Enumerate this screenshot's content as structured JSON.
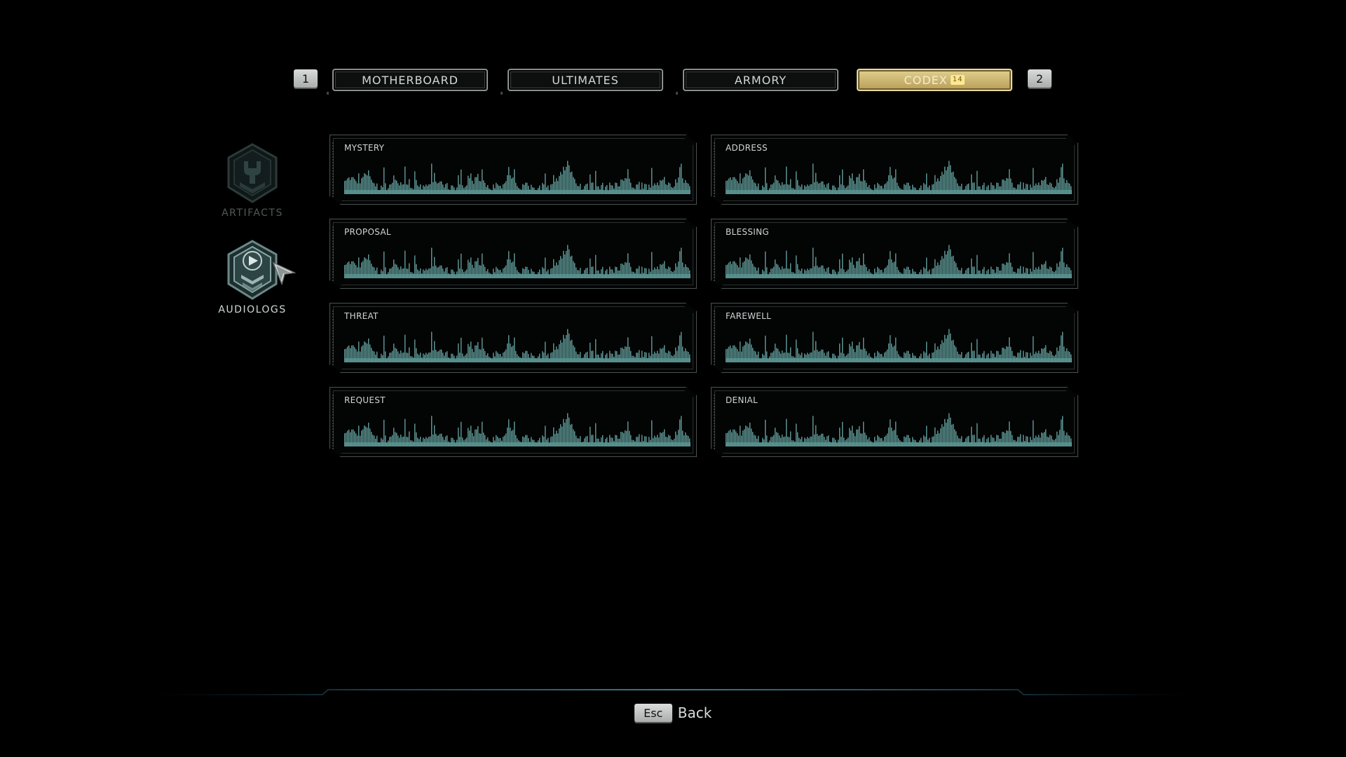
{
  "tabs": {
    "prev_key": "1",
    "next_key": "2",
    "items": [
      {
        "label": "MOTHERBOARD"
      },
      {
        "label": "ULTIMATES"
      },
      {
        "label": "ARMORY"
      },
      {
        "label": "CODEX",
        "badge": "14",
        "active": true
      }
    ]
  },
  "sidebar": {
    "items": [
      {
        "label": "ARTIFACTS",
        "icon": "wrench-hex-icon",
        "selected": false
      },
      {
        "label": "AUDIOLOGS",
        "icon": "play-hex-icon",
        "selected": true
      }
    ]
  },
  "audiologs": [
    {
      "title": "MYSTERY"
    },
    {
      "title": "ADDRESS"
    },
    {
      "title": "PROPOSAL"
    },
    {
      "title": "BLESSING"
    },
    {
      "title": "THREAT"
    },
    {
      "title": "FAREWELL"
    },
    {
      "title": "REQUEST"
    },
    {
      "title": "DENIAL"
    }
  ],
  "footer": {
    "back_key": "Esc",
    "back_label": "Back"
  },
  "colors": {
    "accent_gold": "#e2cf8e",
    "waveform": "#5f9b98",
    "panel_border": "#4a5150"
  }
}
